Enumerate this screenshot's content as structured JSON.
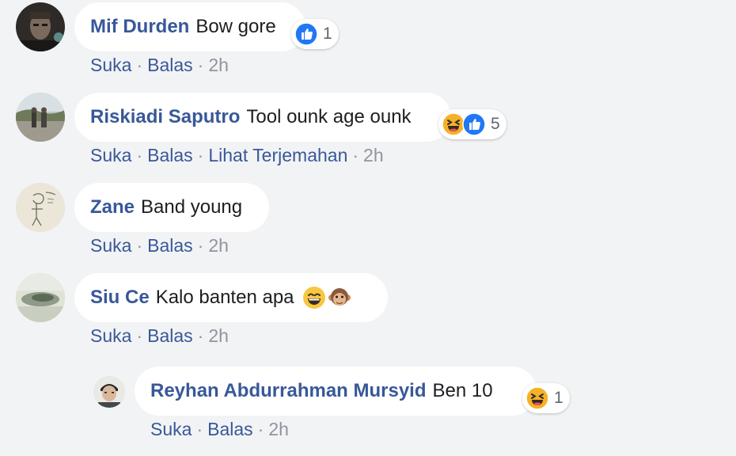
{
  "comments": [
    {
      "author": "Mif Durden",
      "text": "Bow gore",
      "reaction_count": "1",
      "reactions": [
        "like-icon"
      ],
      "actions": [
        "Suka",
        "Balas"
      ],
      "time": "2h"
    },
    {
      "author": "Riskiadi Saputro",
      "text": "Tool ounk age ounk",
      "reaction_count": "5",
      "reactions": [
        "haha-icon",
        "like-icon"
      ],
      "actions": [
        "Suka",
        "Balas",
        "Lihat Terjemahan"
      ],
      "time": "2h"
    },
    {
      "author": "Zane",
      "text": "Band young",
      "actions": [
        "Suka",
        "Balas"
      ],
      "time": "2h"
    },
    {
      "author": "Siu Ce",
      "text": "Kalo banten apa",
      "emojis": [
        "grinning-squint-emoji",
        "monkey-face-emoji"
      ],
      "actions": [
        "Suka",
        "Balas"
      ],
      "time": "2h"
    },
    {
      "author": "Reyhan Abdurrahman Mursyid",
      "text": "Ben 10",
      "reaction_count": "1",
      "reactions": [
        "haha-icon"
      ],
      "actions": [
        "Suka",
        "Balas"
      ],
      "time": "2h",
      "is_reply": true
    }
  ],
  "colors": {
    "background": "#f2f3f5",
    "bubble": "#ffffff",
    "author": "#385898",
    "action_link": "#385898",
    "timestamp": "#90949c",
    "like_blue": "#2078f4",
    "haha_yellow": "#f7b125"
  }
}
